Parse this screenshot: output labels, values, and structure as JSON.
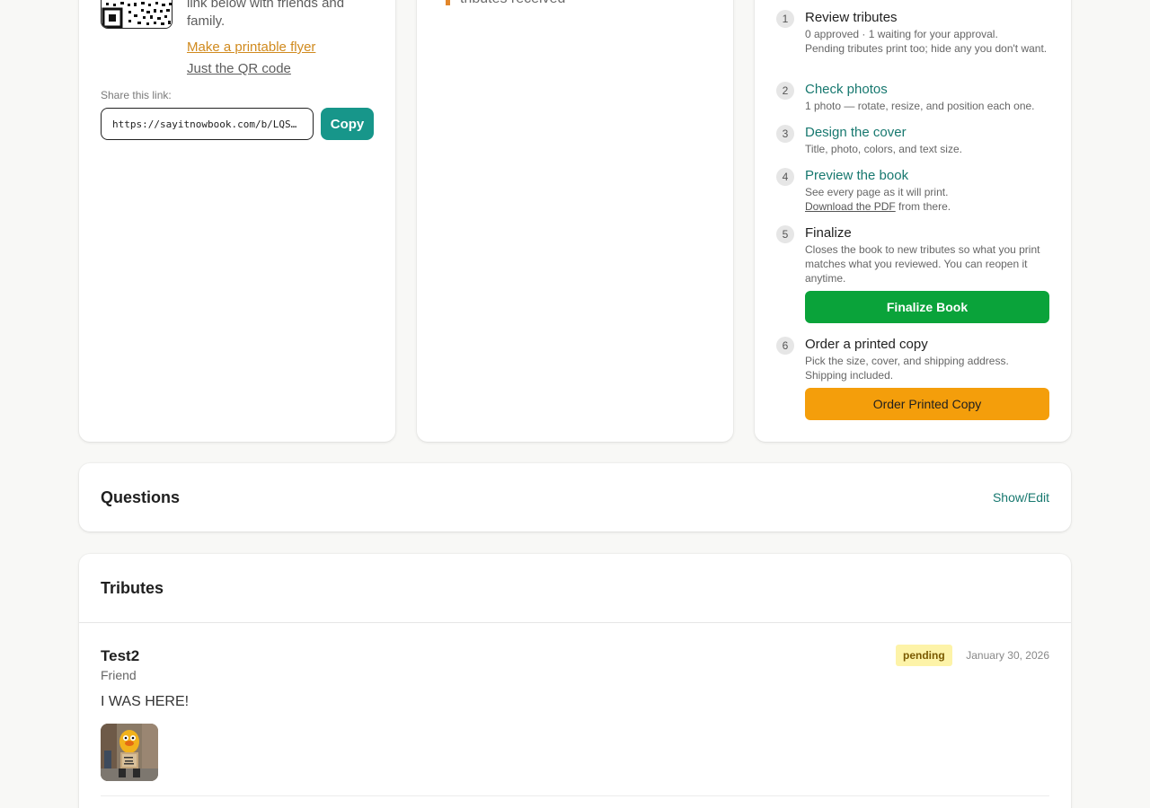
{
  "share": {
    "intro_text": "link below with friends and family.",
    "flyer_link": "Make a printable flyer",
    "qr_link": "Just the QR code",
    "share_label": "Share this link:",
    "share_url": "https://sayitnowbook.com/b/LQS…",
    "copy_label": "Copy"
  },
  "stats": {
    "text": "tributes received"
  },
  "steps": [
    {
      "num": "1",
      "title": "Review tributes",
      "desc_line1": "0 approved · 1 waiting for your approval.",
      "desc_line2": "Pending tributes print too; hide any you don't want."
    },
    {
      "num": "2",
      "title": "Check photos",
      "desc": "1 photo — rotate, resize, and position each one."
    },
    {
      "num": "3",
      "title": "Design the cover",
      "desc": "Title, photo, colors, and text size."
    },
    {
      "num": "4",
      "title": "Preview the book",
      "desc": "See every page as it will print.",
      "desc_link": "Download the PDF",
      "desc_tail": " from there."
    },
    {
      "num": "5",
      "title": "Finalize",
      "desc": "Closes the book to new tributes so what you print matches what you reviewed. You can reopen it anytime.",
      "button": "Finalize Book"
    },
    {
      "num": "6",
      "title": "Order a printed copy",
      "desc": "Pick the size, cover, and shipping address. Shipping included.",
      "button": "Order Printed Copy"
    }
  ],
  "questions": {
    "title": "Questions",
    "action": "Show/Edit"
  },
  "tributes": {
    "title": "Tributes",
    "items": [
      {
        "name": "Test2",
        "relation": "Friend",
        "message": "I WAS HERE!",
        "status": "pending",
        "date": "January 30, 2026"
      }
    ]
  },
  "colors": {
    "accent": "#17968a",
    "finalize": "#0aa33a",
    "order": "#f49e0b",
    "badge_bg": "#fdf3a8",
    "flyer_link": "#d08a1e"
  }
}
